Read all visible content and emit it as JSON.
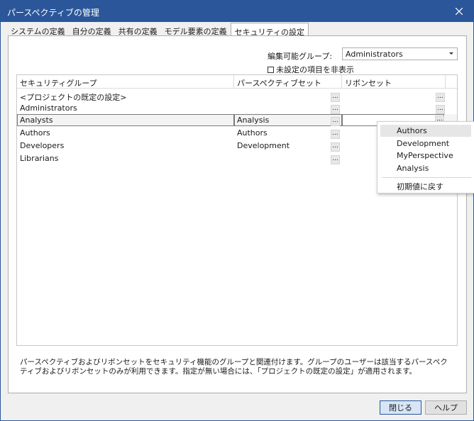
{
  "window": {
    "title": "パースペクティブの管理"
  },
  "tabs": [
    {
      "label": "システムの定義"
    },
    {
      "label": "自分の定義"
    },
    {
      "label": "共有の定義"
    },
    {
      "label": "モデル要素の定義"
    },
    {
      "label": "セキュリティの設定",
      "active": true
    }
  ],
  "group_filter": {
    "label": "編集可能グループ:",
    "value": "Administrators"
  },
  "hide_unset": {
    "label": "未設定の項目を非表示",
    "checked": false
  },
  "grid": {
    "columns": [
      "セキュリティグループ",
      "パースペクティブセット",
      "リボンセット"
    ],
    "rows": [
      {
        "group": "<プロジェクトの既定の設定>",
        "perspective": "",
        "ribbon": ""
      },
      {
        "group": "Administrators",
        "perspective": "",
        "ribbon": ""
      },
      {
        "group": "Analysts",
        "perspective": "Analysis",
        "ribbon": ""
      },
      {
        "group": "Authors",
        "perspective": "Authors",
        "ribbon": ""
      },
      {
        "group": "Developers",
        "perspective": "Development",
        "ribbon": ""
      },
      {
        "group": "Librarians",
        "perspective": "",
        "ribbon": ""
      }
    ],
    "ellipsis": "..."
  },
  "ribbon_menu": {
    "items": [
      "Authors",
      "Development",
      "MyPerspective",
      "Analysis"
    ],
    "reset": "初期値に戻す"
  },
  "description": "パースペクティブおよびリボンセットをセキュリティ機能のグループと関連付けます。グループのユーザーは該当するパースペクティブおよびリボンセットのみが利用できます。指定が無い場合には、「プロジェクトの既定の設定」が適用されます。",
  "buttons": {
    "close": "閉じる",
    "help": "ヘルプ"
  },
  "colors": {
    "titlebar": "#2b579a",
    "selection": "#e6e6e6"
  }
}
